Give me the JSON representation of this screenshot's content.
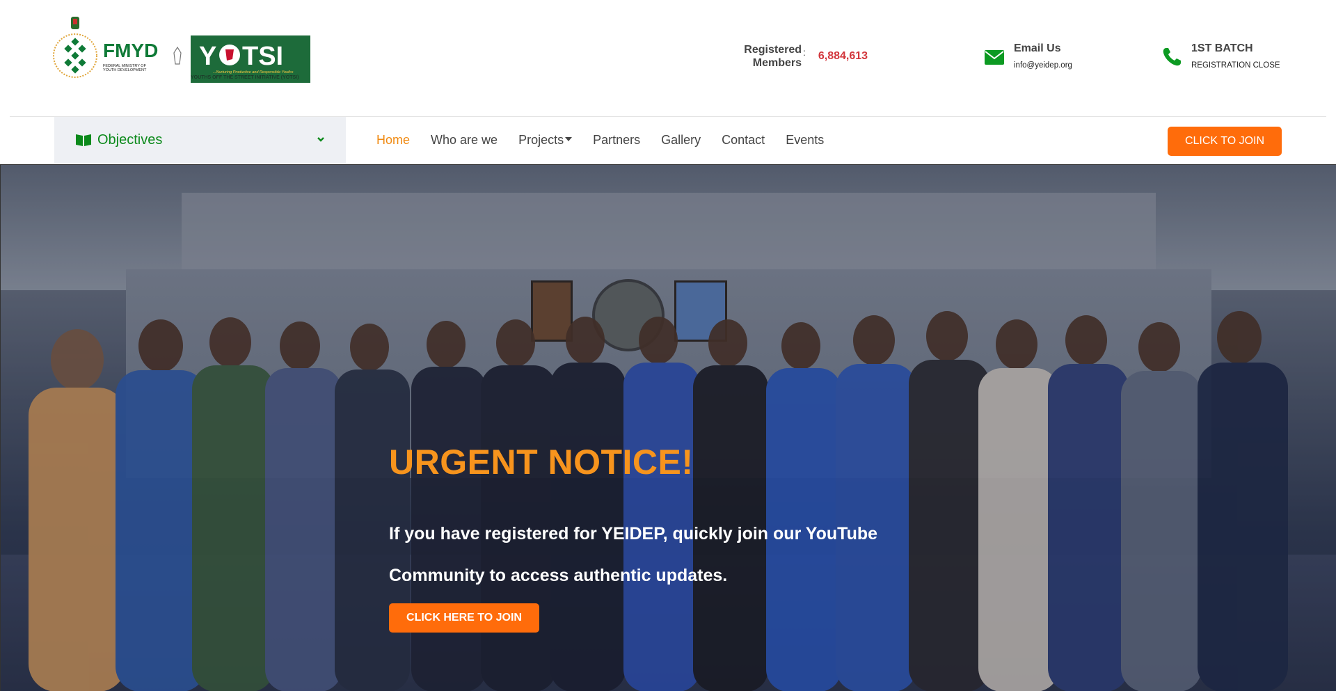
{
  "header": {
    "logo_fmyd_text": "FMYD",
    "logo_fmyd_sub": "FEDERAL MINISTRY OF YOUTH DEVELOPMENT",
    "logo_yotsi_text": "YOTSI",
    "logo_yotsi_tagline": "...Nurturing Productive and Responsible Youths",
    "logo_yotsi_caption": "YOUTHS OFF THE STREET INITIATIVE (YOTSI)",
    "registered_label": "Registered Members",
    "registered_colon": ":",
    "registered_value": "6,884,613",
    "email_title": "Email Us",
    "email_value": "info@yeidep.org",
    "batch_title": "1ST BATCH",
    "batch_sub": "REGISTRATION CLOSE"
  },
  "nav": {
    "objectives_label": "Objectives",
    "items": [
      {
        "label": "Home",
        "active": true
      },
      {
        "label": "Who are we"
      },
      {
        "label": "Projects",
        "dropdown": true
      },
      {
        "label": "Partners"
      },
      {
        "label": "Gallery"
      },
      {
        "label": "Contact"
      },
      {
        "label": "Events"
      }
    ],
    "join_button": "CLICK TO JOIN"
  },
  "hero": {
    "title": "URGENT NOTICE!",
    "text": "If you have registered for YEIDEP, quickly join our YouTube Community to access authentic updates.",
    "cta": "CLICK HERE TO JOIN"
  },
  "colors": {
    "accent_orange": "#ff6c0b",
    "title_orange": "#f7941d",
    "green": "#0c8a1b",
    "red_value": "#d2363c"
  },
  "icons": {
    "email": "envelope-icon",
    "phone": "phone-icon",
    "objectives": "book-icon",
    "dropdown": "chevron-down-icon"
  }
}
